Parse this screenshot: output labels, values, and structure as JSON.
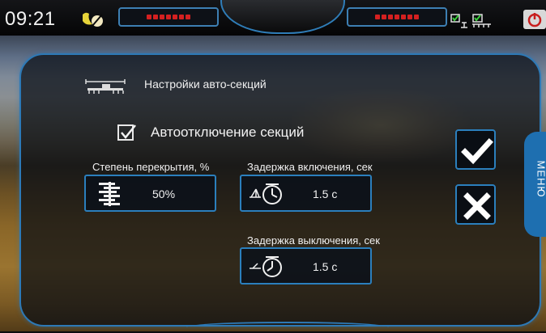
{
  "topbar": {
    "time": "09:21",
    "moon_icon": "night-mode-icon",
    "left_segment_count": 7,
    "right_segment_count": 7,
    "status_icons": "gps-sensor-status-icons",
    "power_icon": "power-icon"
  },
  "dialog": {
    "title": "Настройки авто-секций",
    "title_icon": "sprayer-boom-icon",
    "auto_off": {
      "label": "Автоотключение секций",
      "checked": true
    },
    "overlap": {
      "label": "Степень перекрытия, %",
      "value": "50%",
      "icon": "overlap-bars-icon"
    },
    "on_delay": {
      "label": "Задержка включения, сек",
      "value": "1.5 c",
      "icon": "timer-on-icon"
    },
    "off_delay": {
      "label": "Задержка выключения, сек",
      "value": "1.5 c",
      "icon": "timer-off-icon"
    },
    "confirm_icon": "checkmark-icon",
    "cancel_icon": "close-icon"
  },
  "menu_tab": {
    "label": "МЕНЮ"
  },
  "colors": {
    "accent_blue": "#2b7fbd",
    "segment_red": "#d42020",
    "panel_bg": "#080c14"
  }
}
